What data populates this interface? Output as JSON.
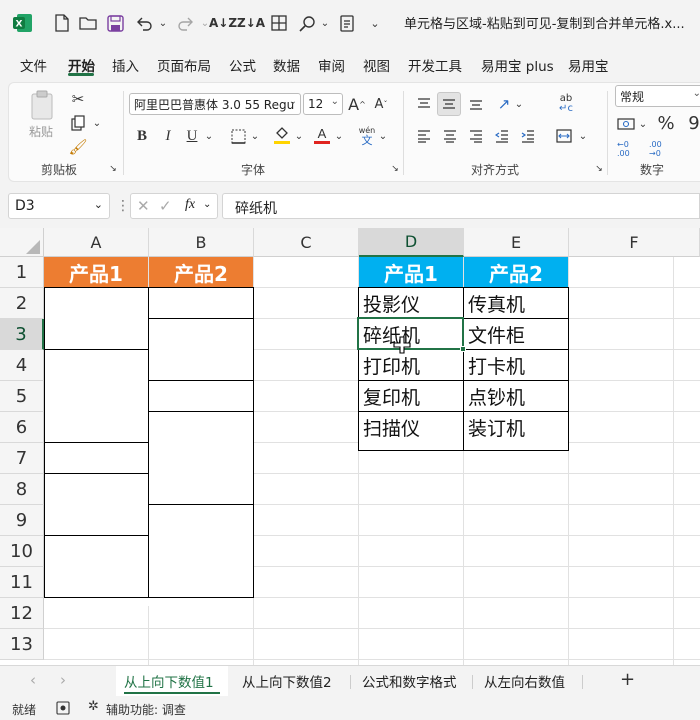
{
  "window": {
    "title": "单元格与区域-粘贴到可见-复制到合并单元格.x..."
  },
  "menu": [
    "文件",
    "开始",
    "插入",
    "页面布局",
    "公式",
    "数据",
    "审阅",
    "视图",
    "开发工具",
    "易用宝 plus",
    "易用宝"
  ],
  "ribbon": {
    "clipboard": {
      "paste_label": "粘贴",
      "group_label": "剪贴板"
    },
    "font": {
      "font_name": "阿里巴巴普惠体 3.0 55 Regu",
      "font_size": "12",
      "group_label": "字体",
      "bold": "B",
      "italic": "I",
      "underline": "U",
      "grow": "A",
      "shrink": "A",
      "wen": "wén",
      "wen2": "文"
    },
    "align": {
      "group_label": "对齐方式",
      "ab": "ab",
      "c": "c"
    },
    "number": {
      "format": "常规",
      "group_label": "数字",
      "percent": "%",
      "comma": "9",
      "inc_decimal": "←0 .00",
      "dec_decimal": ".00 →0"
    }
  },
  "formula_bar": {
    "name_box": "D3",
    "fx": "fx",
    "value": "碎纸机"
  },
  "columns": [
    "A",
    "B",
    "C",
    "D",
    "E",
    "F"
  ],
  "rows": [
    "1",
    "2",
    "3",
    "4",
    "5",
    "6",
    "7",
    "8",
    "9",
    "10",
    "11",
    "12",
    "13"
  ],
  "cells": {
    "A1": "产品1",
    "B1": "产品2",
    "D1": "产品1",
    "E1": "产品2",
    "D": [
      "投影仪",
      "碎纸机",
      "打印机",
      "复印机",
      "扫描仪"
    ],
    "E": [
      "传真机",
      "文件柜",
      "打卡机",
      "点钞机",
      "装订机"
    ]
  },
  "sheet_tabs": [
    "从上向下数值1",
    "从上向下数值2",
    "公式和数字格式",
    "从左向右数值"
  ],
  "status": {
    "ready": "就绪",
    "accessibility": "辅助功能: 调查"
  },
  "colors": {
    "orange": "#ed7d31",
    "blue": "#00b0f0",
    "excel_green": "#217346"
  }
}
